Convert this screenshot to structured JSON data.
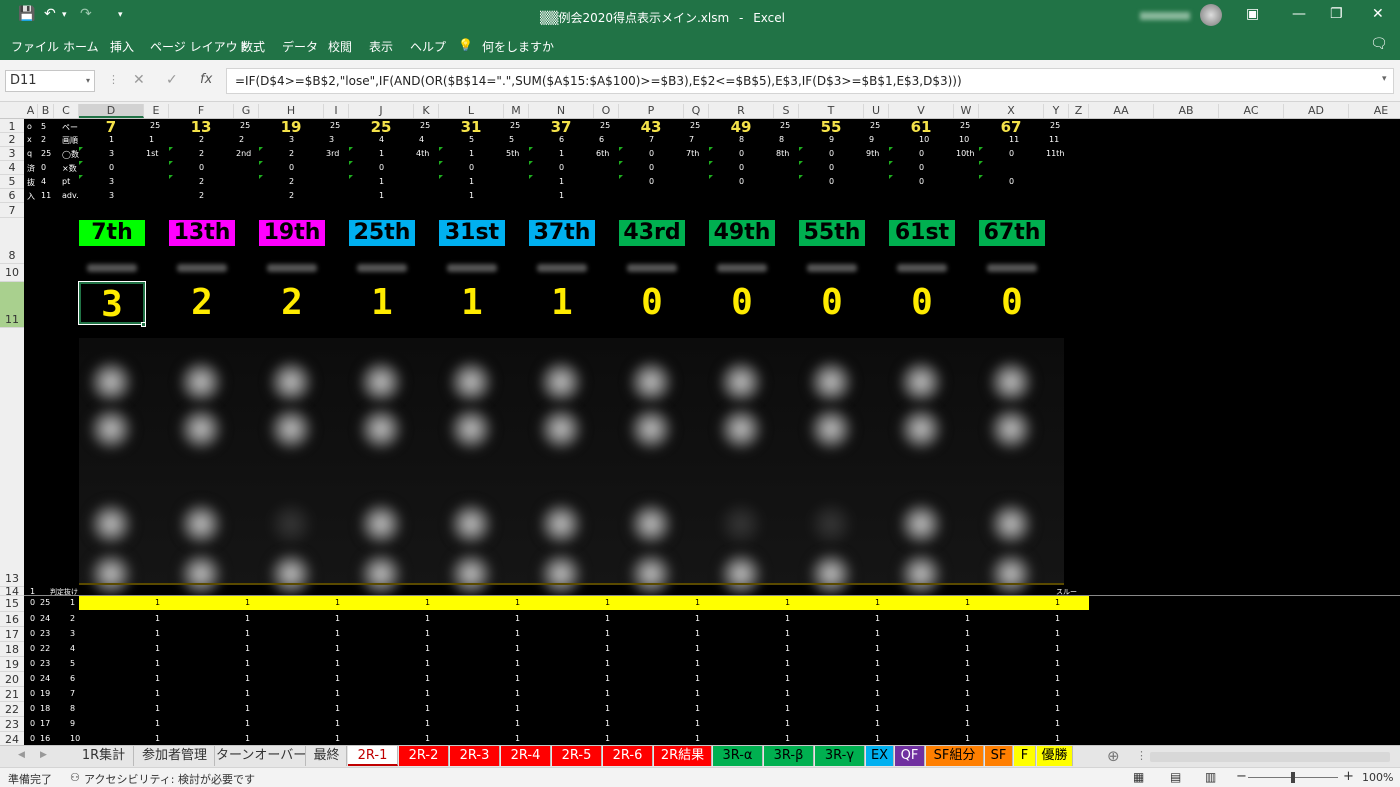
{
  "titlebar": {
    "filename": "▒▒例会2020得点表示メイン.xlsm",
    "sep": "-",
    "app": "Excel"
  },
  "menu": [
    "ファイル",
    "ホーム",
    "挿入",
    "ページ レイアウト",
    "数式",
    "データ",
    "校閲",
    "表示",
    "ヘルプ",
    "何をしますか"
  ],
  "formula": {
    "namebox": "D11",
    "fx": "fx",
    "text": "=IF(D$4>=$B$2,\"lose\",IF(AND(OR($B$14=\".\",SUM($A$15:$A$100)>=$B3),E$2<=$B$5),E$3,IF(D$3>=$B$1,E$3,D$3)))"
  },
  "columns": [
    "A",
    "B",
    "C",
    "D",
    "E",
    "F",
    "G",
    "H",
    "I",
    "J",
    "K",
    "L",
    "M",
    "N",
    "O",
    "P",
    "Q",
    "R",
    "S",
    "T",
    "U",
    "V",
    "W",
    "X",
    "Y",
    "Z",
    "AA",
    "AB",
    "AC",
    "AD",
    "AE"
  ],
  "rows": [
    "1",
    "2",
    "3",
    "4",
    "5",
    "6",
    "7",
    "8",
    "10",
    "11",
    "13",
    "14",
    "15",
    "16",
    "17",
    "18",
    "19",
    "20",
    "21",
    "22",
    "23",
    "24"
  ],
  "left_labels": {
    "r1": [
      "o",
      "5",
      "ペー"
    ],
    "r2": [
      "x",
      "2",
      "画順"
    ],
    "r3": [
      "q",
      "25",
      "◯数"
    ],
    "r4": [
      "済",
      "0",
      "×数"
    ],
    "r5": [
      "抜",
      "4",
      "pt"
    ],
    "r6": [
      "入",
      "11",
      "adv."
    ]
  },
  "top_numbers": [
    "7",
    "13",
    "19",
    "25",
    "31",
    "37",
    "43",
    "49",
    "55",
    "61",
    "67"
  ],
  "between_numbers": [
    "25",
    "25",
    "25",
    "25",
    "25",
    "25",
    "25",
    "25",
    "25",
    "25",
    "25"
  ],
  "row2_values": [
    "1",
    "1",
    "2",
    "2",
    "3",
    "3",
    "4",
    "4",
    "5",
    "5",
    "6",
    "6",
    "7",
    "7",
    "8",
    "8",
    "9",
    "9",
    "10",
    "10",
    "11",
    "11"
  ],
  "row3_values": [
    "3",
    "1st",
    "2",
    "2nd",
    "2",
    "3rd",
    "1",
    "4th",
    "1",
    "5th",
    "1",
    "6th",
    "0",
    "7th",
    "0",
    "8th",
    "0",
    "9th",
    "0",
    "10th",
    "0",
    "11th"
  ],
  "row4_values": [
    "0",
    "0",
    "0",
    "0",
    "0",
    "0",
    "0",
    "0",
    "0",
    "0"
  ],
  "row5_values": [
    "3",
    "2",
    "2",
    "1",
    "1",
    "1",
    "0",
    "0",
    "0",
    "0",
    "0"
  ],
  "row6_values": [
    "3",
    "2",
    "2",
    "1",
    "1",
    "1"
  ],
  "banners": [
    {
      "label": "7th",
      "color": "#00ff00"
    },
    {
      "label": "13th",
      "color": "#ff00ff"
    },
    {
      "label": "19th",
      "color": "#ff00ff"
    },
    {
      "label": "25th",
      "color": "#00b0f0"
    },
    {
      "label": "31st",
      "color": "#00b0f0"
    },
    {
      "label": "37th",
      "color": "#00b0f0"
    },
    {
      "label": "43rd",
      "color": "#00b050"
    },
    {
      "label": "49th",
      "color": "#00b050"
    },
    {
      "label": "55th",
      "color": "#00b050"
    },
    {
      "label": "61st",
      "color": "#00b050"
    },
    {
      "label": "67th",
      "color": "#00b050"
    }
  ],
  "scores": [
    "3",
    "2",
    "2",
    "1",
    "1",
    "1",
    "0",
    "0",
    "0",
    "0",
    "0"
  ],
  "row14": {
    "a": "1",
    "label": "判定抜け",
    "right": "スルー"
  },
  "data_rows": [
    {
      "a": "0",
      "b": "25",
      "c": "1"
    },
    {
      "a": "0",
      "b": "24",
      "c": "2"
    },
    {
      "a": "0",
      "b": "23",
      "c": "3"
    },
    {
      "a": "0",
      "b": "22",
      "c": "4"
    },
    {
      "a": "0",
      "b": "23",
      "c": "5"
    },
    {
      "a": "0",
      "b": "24",
      "c": "6"
    },
    {
      "a": "0",
      "b": "19",
      "c": "7"
    },
    {
      "a": "0",
      "b": "18",
      "c": "8"
    },
    {
      "a": "0",
      "b": "17",
      "c": "9"
    },
    {
      "a": "0",
      "b": "16",
      "c": "10"
    }
  ],
  "ones": "1",
  "tabs": [
    {
      "label": "1R集計",
      "bg": "#e6e6e6",
      "fg": "#333"
    },
    {
      "label": "参加者管理",
      "bg": "#e6e6e6",
      "fg": "#333"
    },
    {
      "label": "ターンオーバー",
      "bg": "#e6e6e6",
      "fg": "#333"
    },
    {
      "label": "最終",
      "bg": "#e6e6e6",
      "fg": "#333"
    },
    {
      "label": "2R-1",
      "bg": "#ffffff",
      "fg": "#c00000"
    },
    {
      "label": "2R-2",
      "bg": "#ff0000",
      "fg": "#fff"
    },
    {
      "label": "2R-3",
      "bg": "#ff0000",
      "fg": "#fff"
    },
    {
      "label": "2R-4",
      "bg": "#ff0000",
      "fg": "#fff"
    },
    {
      "label": "2R-5",
      "bg": "#ff0000",
      "fg": "#fff"
    },
    {
      "label": "2R-6",
      "bg": "#ff0000",
      "fg": "#fff"
    },
    {
      "label": "2R結果",
      "bg": "#ff0000",
      "fg": "#fff"
    },
    {
      "label": "3R-α",
      "bg": "#00b050",
      "fg": "#000"
    },
    {
      "label": "3R-β",
      "bg": "#00b050",
      "fg": "#000"
    },
    {
      "label": "3R-γ",
      "bg": "#00b050",
      "fg": "#000"
    },
    {
      "label": "EX",
      "bg": "#00b0f0",
      "fg": "#000"
    },
    {
      "label": "QF",
      "bg": "#7030a0",
      "fg": "#fff"
    },
    {
      "label": "SF組分",
      "bg": "#ff7f00",
      "fg": "#000"
    },
    {
      "label": "SF",
      "bg": "#ff7f00",
      "fg": "#000"
    },
    {
      "label": "F",
      "bg": "#ffff00",
      "fg": "#000"
    },
    {
      "label": "優勝",
      "bg": "#ffff00",
      "fg": "#000"
    }
  ],
  "status": {
    "ready": "準備完了",
    "accessibility": "アクセシビリティ: 検討が必要です",
    "zoom": "100%"
  }
}
